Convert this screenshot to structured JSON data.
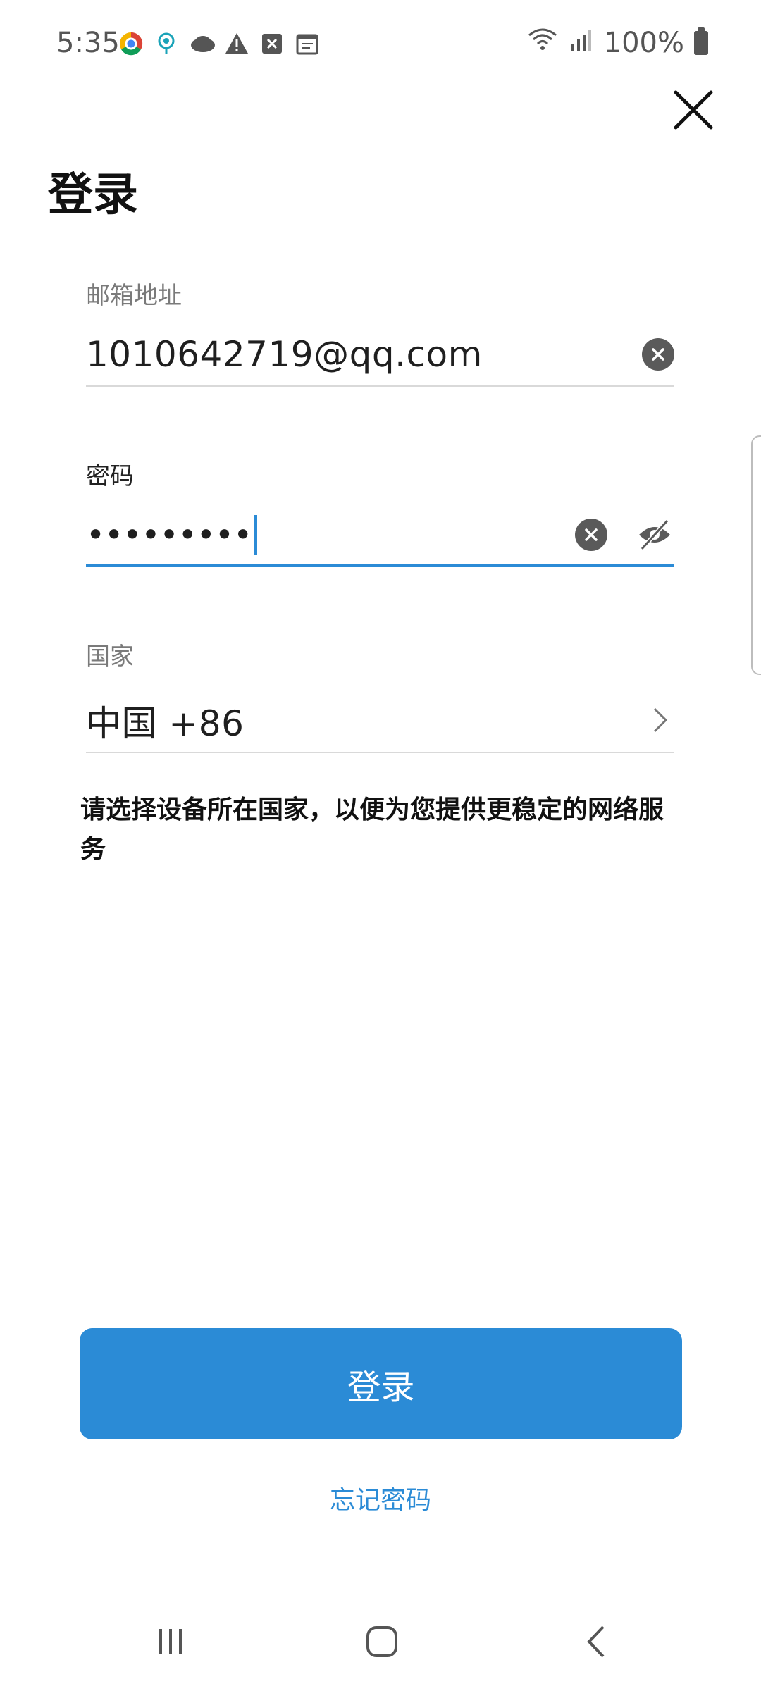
{
  "status_bar": {
    "time": "5:35",
    "battery_text": "100%",
    "left_icons": [
      "chrome-icon",
      "location-icon",
      "cloud-icon",
      "warning-icon",
      "close-square-icon",
      "calendar-icon"
    ],
    "right_icons": [
      "wifi-icon",
      "signal-icon",
      "battery-icon"
    ]
  },
  "page": {
    "title": "登录"
  },
  "email": {
    "label": "邮箱地址",
    "value": "1010642719@qq.com"
  },
  "password": {
    "label": "密码",
    "masked_value": "•••••••••"
  },
  "country": {
    "label": "国家",
    "value": "中国 +86"
  },
  "hint": {
    "text": "请选择设备所在国家，以便为您提供更稳定的网络服务"
  },
  "actions": {
    "login_label": "登录",
    "forgot_label": "忘记密码"
  },
  "colors": {
    "accent": "#2b8bd6",
    "text": "#1f1f1f",
    "label": "#7a7a7a",
    "divider": "#d9d9d9"
  }
}
